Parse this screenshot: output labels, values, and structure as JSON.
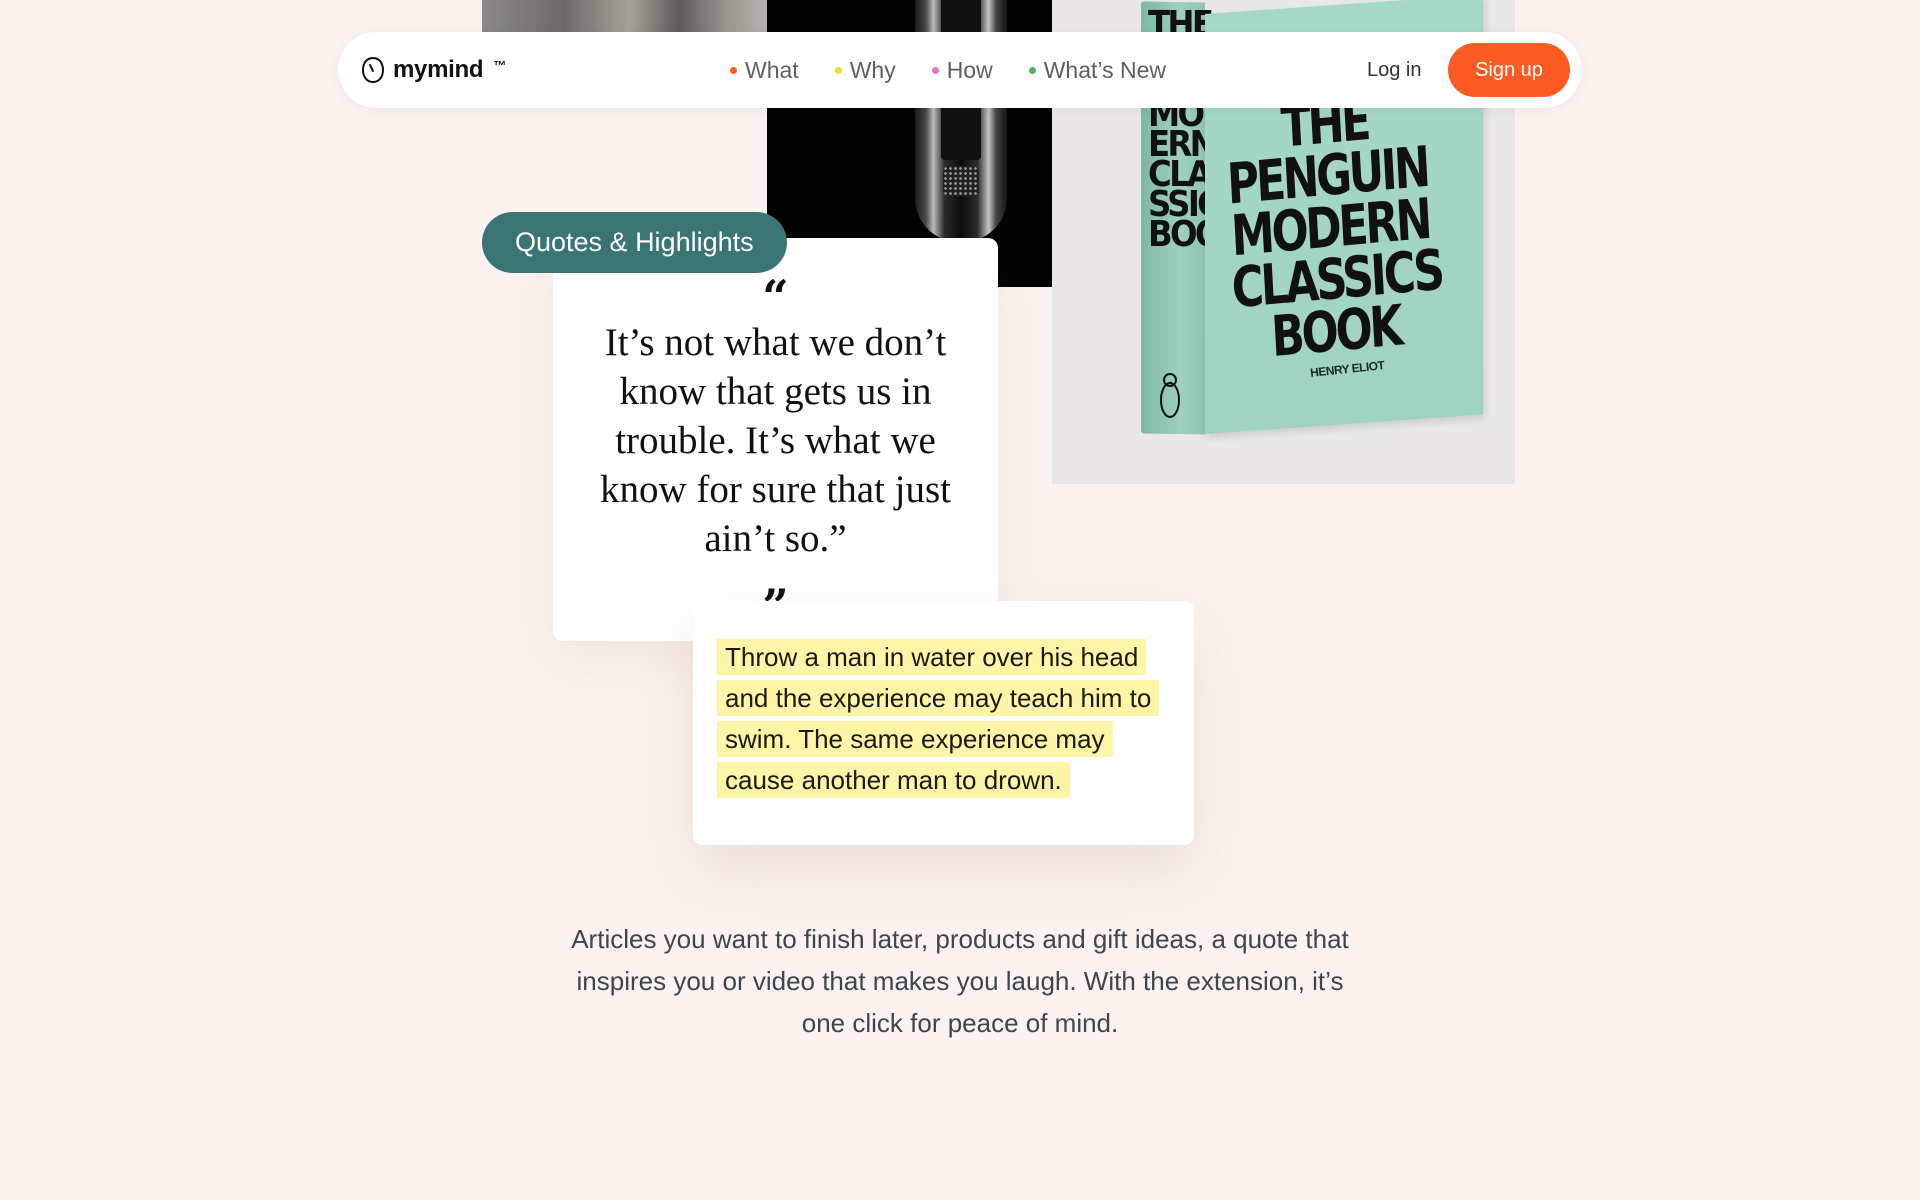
{
  "brand": {
    "name": "mymind",
    "trademark": "™"
  },
  "nav": {
    "links": [
      {
        "label": "What",
        "dot_color": "#fb5a22"
      },
      {
        "label": "Why",
        "dot_color": "#f2dc2a"
      },
      {
        "label": "How",
        "dot_color": "#ef6fc0"
      },
      {
        "label": "What’s New",
        "dot_color": "#52b356"
      }
    ],
    "login_label": "Log in",
    "signup_label": "Sign up"
  },
  "book": {
    "spine_text": "THE\nPEN\nGUIN\nMOD\nERN\nCLA\nSSICS\nBOOK",
    "cover_title": "THE\nPENGUIN\nMODERN\nCLASSICS\nBOOK",
    "author": "HENRY ELIOT"
  },
  "quote_card": {
    "tag": "Quotes & Highlights",
    "open_mark": "“",
    "close_mark": "”",
    "text": "It’s not what we don’t know that gets us in trouble. It’s what we know for sure that just ain’t so.”"
  },
  "highlight_card": {
    "text": "Throw a man in water over his head and the experience may teach him to swim. The same experience may cause another man to drown."
  },
  "description": {
    "text": "Articles you want to finish later, products and gift ideas, a quote that inspires you or video that makes you laugh. With the extension, it’s one click for peace of mind."
  },
  "colors": {
    "background": "#fdf2ef",
    "accent": "#fb5a22",
    "tag": "#3a7475",
    "highlight": "#fff5a7"
  }
}
